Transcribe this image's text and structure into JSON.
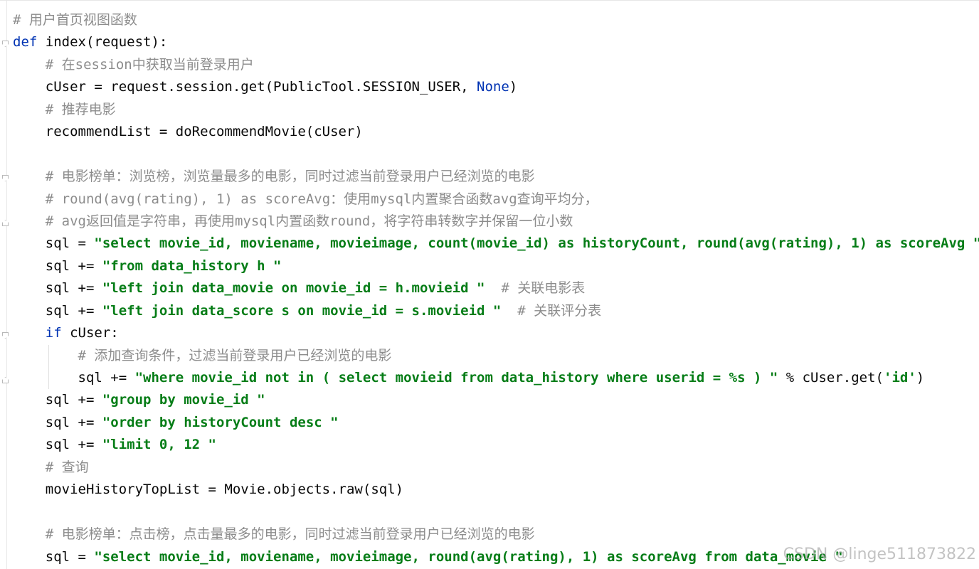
{
  "code_lines": [
    [
      {
        "t": "# 用户首页视图函数",
        "c": "cmt"
      }
    ],
    [
      {
        "t": "def",
        "c": "kw"
      },
      {
        "t": " index(request):"
      }
    ],
    [
      {
        "t": "    "
      },
      {
        "t": "# 在session中获取当前登录用户",
        "c": "cmt"
      }
    ],
    [
      {
        "t": "    cUser = request.session.get(PublicTool.SESSION_USER, "
      },
      {
        "t": "None",
        "c": "kw"
      },
      {
        "t": ")"
      }
    ],
    [
      {
        "t": "    "
      },
      {
        "t": "# 推荐电影",
        "c": "cmt"
      }
    ],
    [
      {
        "t": "    recommendList = doRecommendMovie(cUser)"
      }
    ],
    [
      {
        "t": ""
      }
    ],
    [
      {
        "t": "    "
      },
      {
        "t": "# 电影榜单：浏览榜，浏览量最多的电影，同时过滤当前登录用户已经浏览的电影",
        "c": "cmt"
      }
    ],
    [
      {
        "t": "    "
      },
      {
        "t": "# round(avg(rating), 1) as scoreAvg：使用mysql内置聚合函数avg查询平均分，",
        "c": "cmt"
      }
    ],
    [
      {
        "t": "    "
      },
      {
        "t": "# avg返回值是字符串，再使用mysql内置函数round，将字符串转数字并保留一位小数",
        "c": "cmt"
      }
    ],
    [
      {
        "t": "    sql = "
      },
      {
        "t": "\"select movie_id, moviename, movieimage, count(movie_id) as historyCount, round(avg(rating), 1) as scoreAvg \"",
        "c": "str"
      }
    ],
    [
      {
        "t": "    sql += "
      },
      {
        "t": "\"from data_history h \"",
        "c": "str"
      }
    ],
    [
      {
        "t": "    sql += "
      },
      {
        "t": "\"left join data_movie on movie_id = h.movieid \"",
        "c": "str"
      },
      {
        "t": "  "
      },
      {
        "t": "# 关联电影表",
        "c": "cmt"
      }
    ],
    [
      {
        "t": "    sql += "
      },
      {
        "t": "\"left join data_score s on movie_id = s.movieid \"",
        "c": "str"
      },
      {
        "t": "  "
      },
      {
        "t": "# 关联评分表",
        "c": "cmt"
      }
    ],
    [
      {
        "t": "    "
      },
      {
        "t": "if",
        "c": "kw"
      },
      {
        "t": " cUser:"
      }
    ],
    [
      {
        "t": "        "
      },
      {
        "t": "# 添加查询条件，过滤当前登录用户已经浏览的电影",
        "c": "cmt"
      }
    ],
    [
      {
        "t": "        sql += "
      },
      {
        "t": "\"where movie_id not in ( select movieid from data_history where userid = %s ) \"",
        "c": "str"
      },
      {
        "t": " % cUser.get("
      },
      {
        "t": "'id'",
        "c": "str"
      },
      {
        "t": ")"
      }
    ],
    [
      {
        "t": "    sql += "
      },
      {
        "t": "\"group by movie_id \"",
        "c": "str"
      }
    ],
    [
      {
        "t": "    sql += "
      },
      {
        "t": "\"order by historyCount desc \"",
        "c": "str"
      }
    ],
    [
      {
        "t": "    sql += "
      },
      {
        "t": "\"limit 0, 12 \"",
        "c": "str"
      }
    ],
    [
      {
        "t": "    "
      },
      {
        "t": "# 查询",
        "c": "cmt"
      }
    ],
    [
      {
        "t": "    movieHistoryTopList = Movie.objects.raw(sql)"
      }
    ],
    [
      {
        "t": ""
      }
    ],
    [
      {
        "t": "    "
      },
      {
        "t": "# 电影榜单：点击榜，点击量最多的电影，同时过滤当前登录用户已经浏览的电影",
        "c": "cmt"
      }
    ],
    [
      {
        "t": "    sql = "
      },
      {
        "t": "\"select movie_id, moviename, movieimage, round(avg(rating), 1) as scoreAvg from data_movie \"",
        "c": "str"
      }
    ]
  ],
  "watermark": "CSDN @linge511873822",
  "colors": {
    "keyword": "#0033b3",
    "string": "#067d17",
    "comment": "#8c8c8c",
    "text": "#080808"
  }
}
